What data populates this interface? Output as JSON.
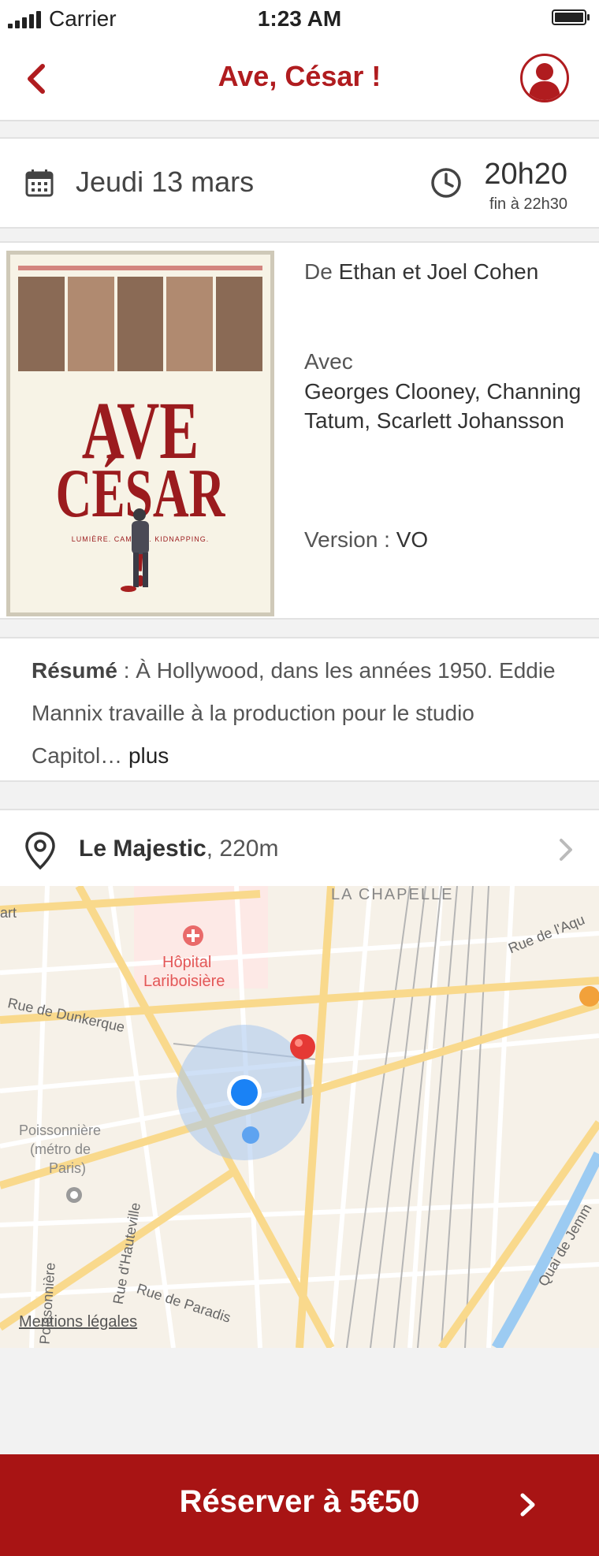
{
  "status_bar": {
    "carrier": "Carrier",
    "time": "1:23 AM"
  },
  "header": {
    "back_icon": "chevron-left-icon",
    "title": "Ave, César !",
    "profile_icon": "user-avatar-icon"
  },
  "showtime": {
    "date": "Jeudi 13 mars",
    "start_time": "20h20",
    "end_time": "fin à 22h30"
  },
  "movie": {
    "poster_title_line1": "AVE",
    "poster_title_line2": "CÉSAR !",
    "poster_tagline": "LUMIÈRE. CAMÉRA. KIDNAPPING.",
    "director_prefix": "De",
    "director": "Ethan et Joel Cohen",
    "cast_label": "Avec",
    "cast": "Georges Clooney, Channing Tatum, Scarlett Johansson",
    "version_label": "Version :",
    "version": "VO"
  },
  "summary": {
    "label": "Résumé",
    "text": " : À Hollywood, dans les années 1950. Eddie Mannix travaille à la production pour le studio Capitol… ",
    "more": "plus"
  },
  "cinema": {
    "name": "Le Majestic",
    "distance": ", 220m"
  },
  "map": {
    "labels": {
      "la_chapelle": "LA CHAPELLE",
      "hopital_1": "Hôpital",
      "hopital_2": "Lariboisière",
      "rue_dunkerque": "Rue de Dunkerque",
      "poissonniere_1": "Poissonnière",
      "poissonniere_2": "(métro de",
      "poissonniere_3": "Paris)",
      "rue_hauteville": "Rue d'Hauteville",
      "rue_paradis": "Rue de Paradis",
      "rue_aqueduc": "Rue de l'Aqu",
      "quai_jemmapes": "Quai de Jemm",
      "faub_poissonniere": "g Poissonnière",
      "art": "art"
    },
    "legal": "Mentions légales"
  },
  "footer": {
    "reserve_label": "Réserver à 5€50"
  },
  "colors": {
    "brand_red": "#b01c1f",
    "button_red": "#a81414",
    "map_user_dot": "#1a82f5"
  }
}
